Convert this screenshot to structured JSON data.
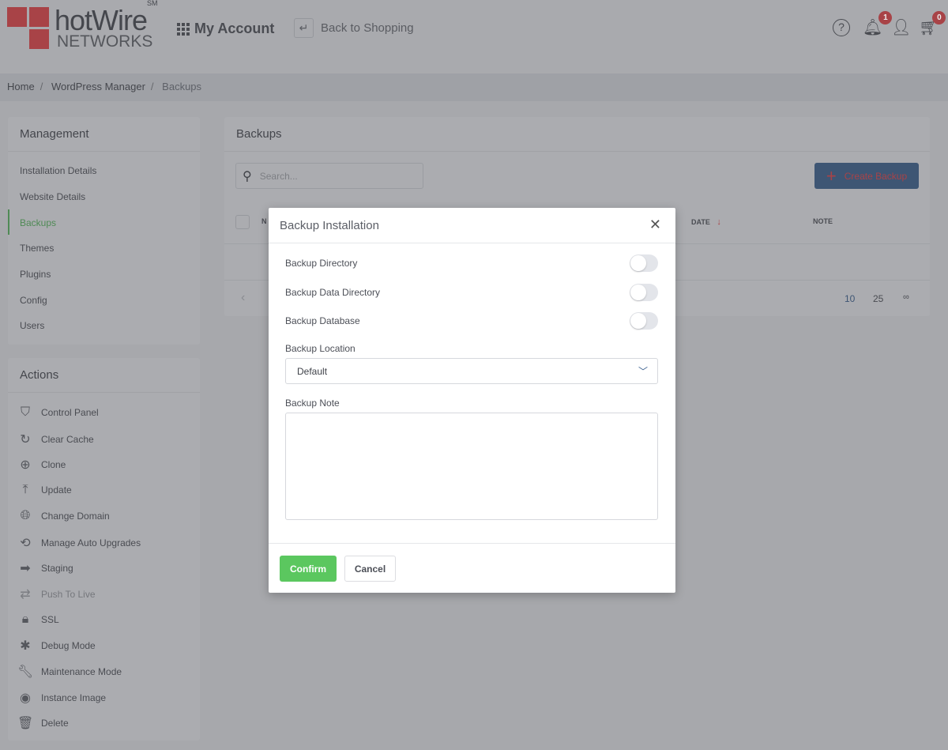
{
  "header": {
    "brand": "hotWire",
    "brand_mark": "SM",
    "brand_sub": "NETWORKS",
    "my_account": "My Account",
    "back_to_shopping": "Back to Shopping",
    "notifications_count": "1",
    "cart_count": "0"
  },
  "breadcrumb": [
    "Home",
    "WordPress Manager",
    "Backups"
  ],
  "management": {
    "title": "Management",
    "items": [
      "Installation Details",
      "Website Details",
      "Backups",
      "Themes",
      "Plugins",
      "Config",
      "Users"
    ],
    "active": "Backups"
  },
  "actions": {
    "title": "Actions",
    "items": [
      {
        "label": "Control Panel",
        "icon": "shield-icon"
      },
      {
        "label": "Clear Cache",
        "icon": "refresh-icon"
      },
      {
        "label": "Clone",
        "icon": "clone-icon"
      },
      {
        "label": "Update",
        "icon": "upload-icon"
      },
      {
        "label": "Change Domain",
        "icon": "globe-icon"
      },
      {
        "label": "Manage Auto Upgrades",
        "icon": "history-icon"
      },
      {
        "label": "Staging",
        "icon": "arrow-right-icon"
      },
      {
        "label": "Push To Live",
        "icon": "swap-icon",
        "disabled": true
      },
      {
        "label": "SSL",
        "icon": "lock-icon"
      },
      {
        "label": "Debug Mode",
        "icon": "bug-icon"
      },
      {
        "label": "Maintenance Mode",
        "icon": "wrench-icon"
      },
      {
        "label": "Instance Image",
        "icon": "image-icon"
      },
      {
        "label": "Delete",
        "icon": "trash-icon"
      }
    ]
  },
  "backups": {
    "title": "Backups",
    "search_placeholder": "Search...",
    "create_label": "Create Backup",
    "columns": [
      "N",
      "DATE",
      "NOTE"
    ],
    "page_sizes": [
      "10",
      "25",
      "∞"
    ]
  },
  "modal": {
    "title": "Backup Installation",
    "toggles": [
      {
        "label": "Backup Directory",
        "on": false
      },
      {
        "label": "Backup Data Directory",
        "on": false
      },
      {
        "label": "Backup Database",
        "on": false
      }
    ],
    "location_label": "Backup Location",
    "location_value": "Default",
    "note_label": "Backup Note",
    "note_value": "",
    "confirm": "Confirm",
    "cancel": "Cancel"
  },
  "colors": {
    "brand_red": "#a84347",
    "confirm_green": "#5bc75f",
    "create_blue": "#3e5674"
  }
}
